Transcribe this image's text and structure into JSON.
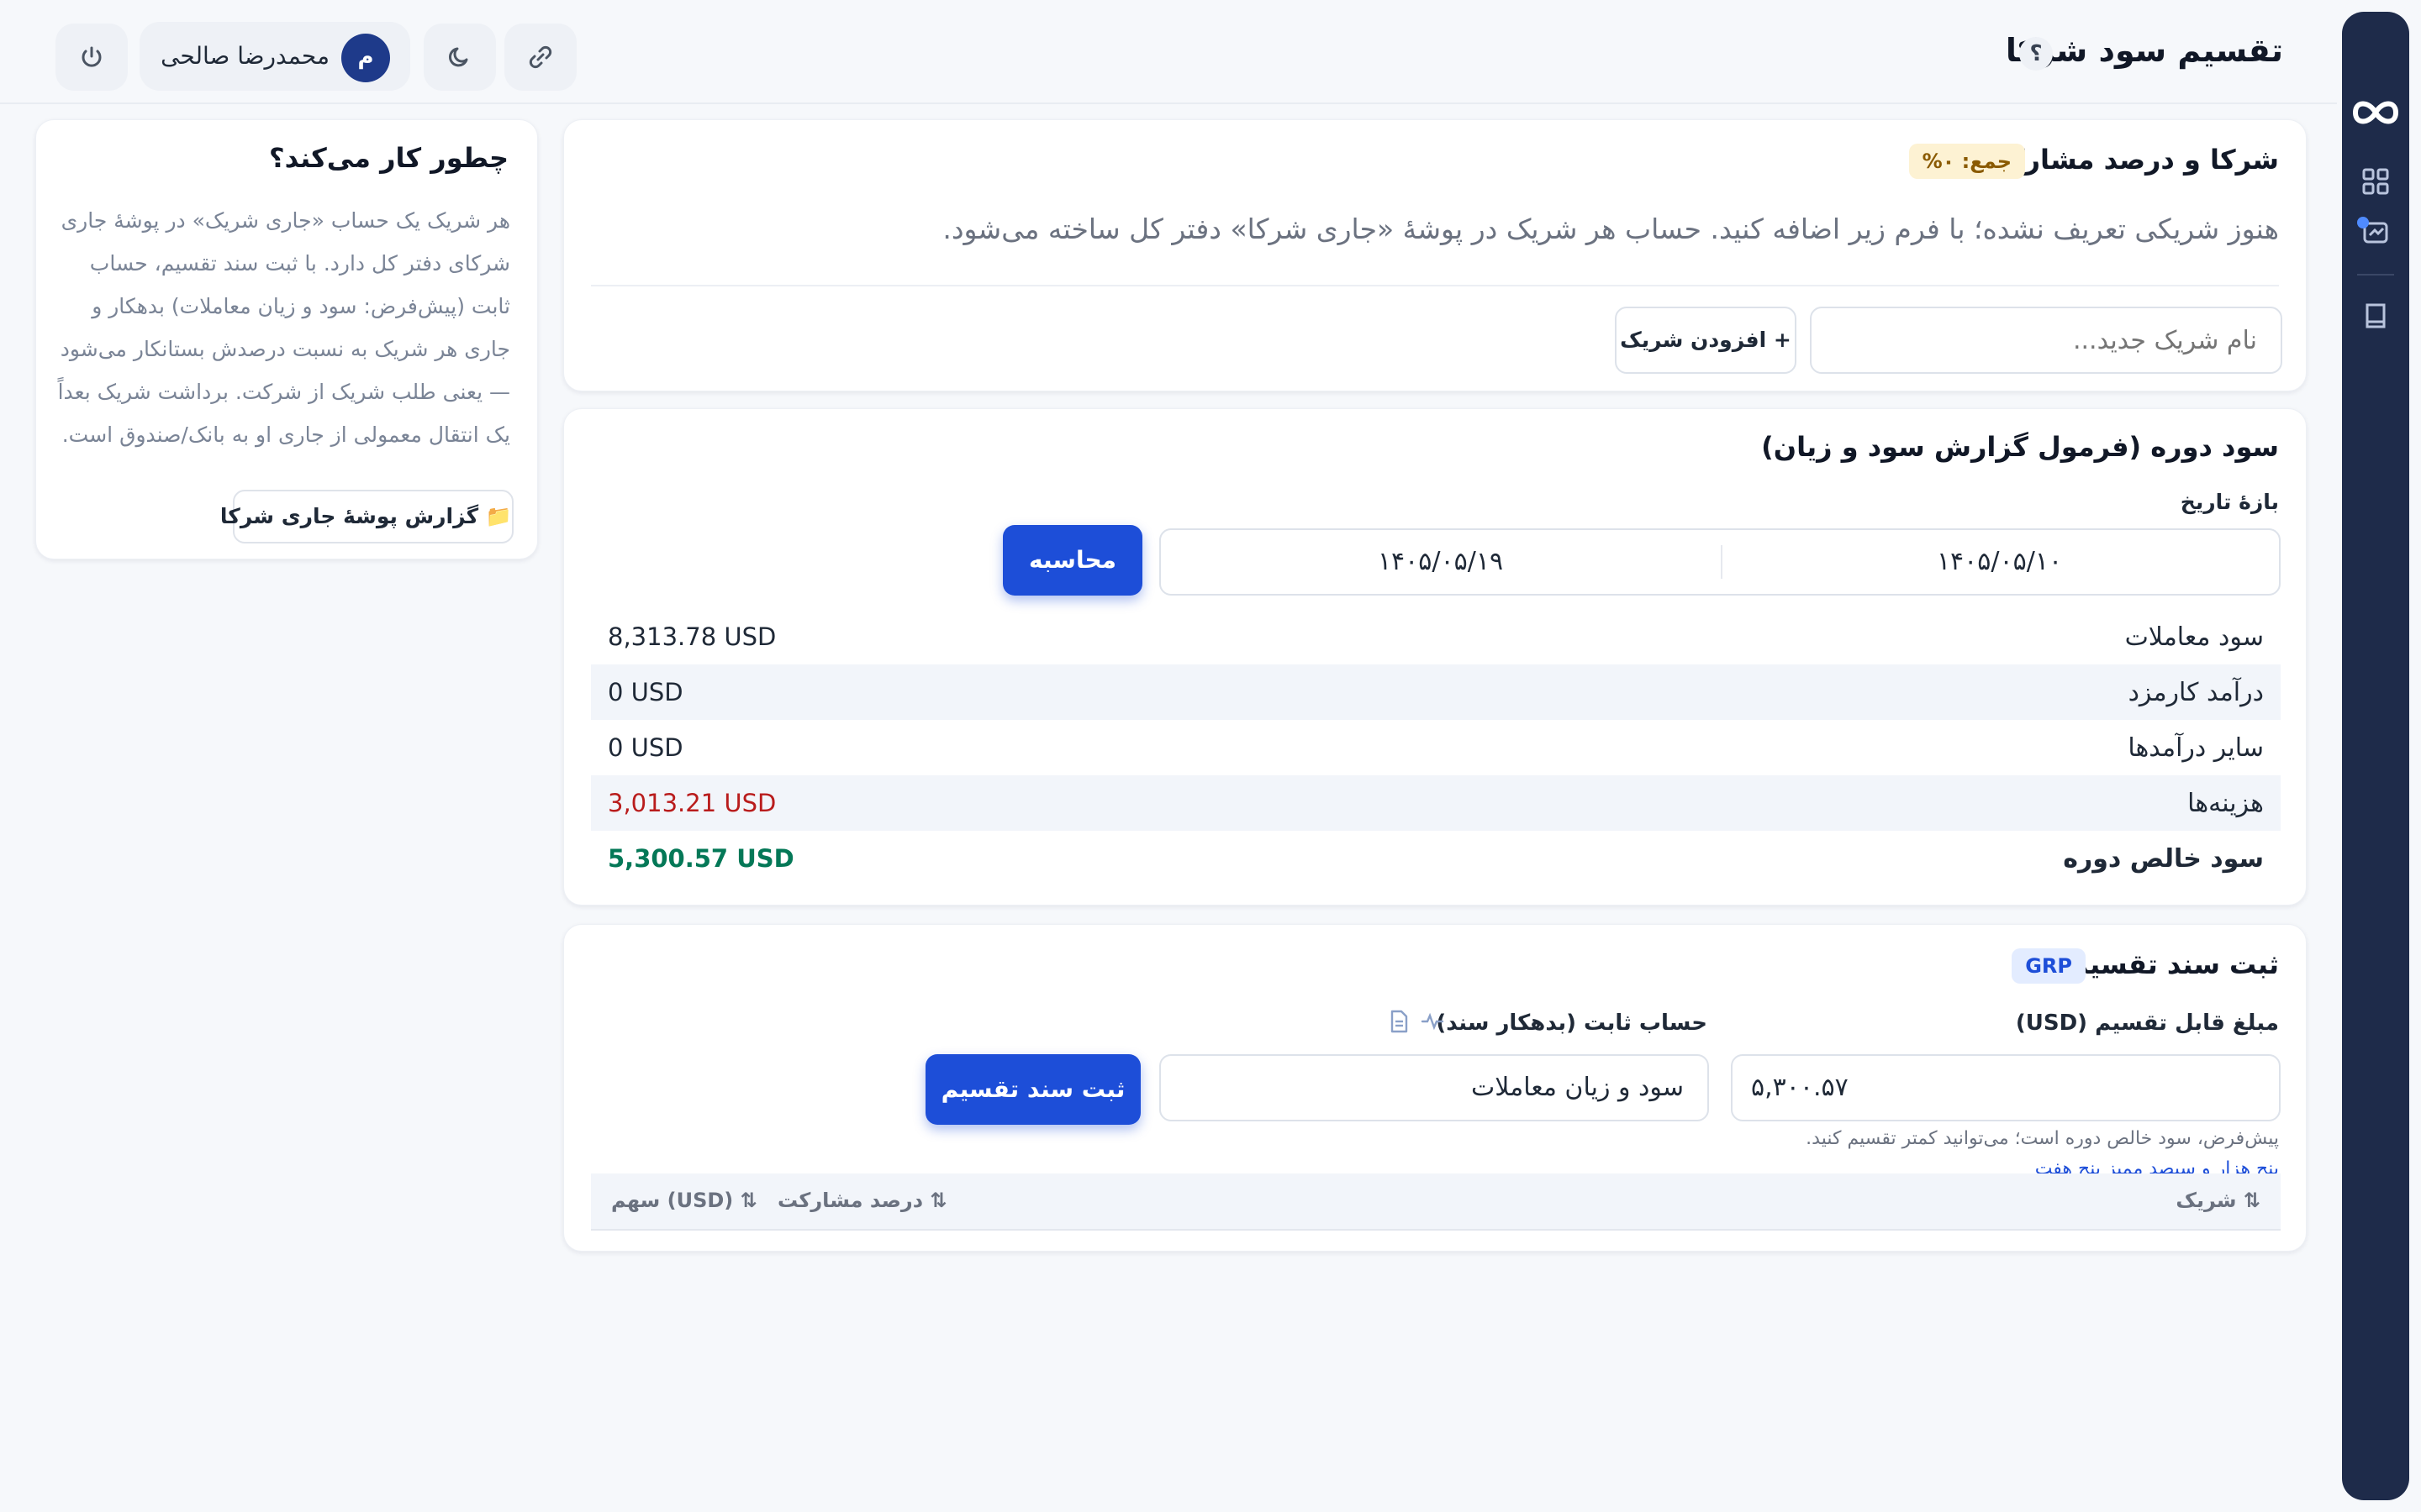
{
  "header": {
    "title": "تقسیم سود شرکا",
    "help_label": "؟",
    "user_name": "محمدرضا صالحی",
    "user_initial": "م"
  },
  "how_it_works": {
    "title": "چطور کار می‌کند؟",
    "body": "هر شریک یک حساب «جاری شریک» در پوشهٔ جاری شرکای دفتر کل دارد. با ثبت سند تقسیم، حساب ثابت (پیش‌فرض: سود و زیان معاملات) بدهکار و جاری هر شریک به نسبت درصدش بستانکار می‌شود — یعنی طلب شریک از شرکت. برداشت شریک بعداً یک انتقال معمولی از جاری او به بانک/صندوق است.",
    "report_button": "📁 گزارش پوشهٔ جاری شرکا"
  },
  "partners": {
    "title": "شرکا و درصد مشارکت",
    "total_badge": "جمع: ۰%",
    "empty_message": "هنوز شریکی تعریف نشده؛ با فرم زیر اضافه کنید. حساب هر شریک در پوشهٔ «جاری شرکا» دفتر کل ساخته می‌شود.",
    "new_partner_placeholder": "نام شریک جدید...",
    "add_button": "+ افزودن شریک"
  },
  "period_profit": {
    "title": "سود دوره (فرمول گزارش سود و زیان)",
    "date_range_label": "بازهٔ تاریخ",
    "date_from": "۱۴۰۵/۰۵/۱۰",
    "date_to": "۱۴۰۵/۰۵/۱۹",
    "calculate_button": "محاسبه",
    "rows": [
      {
        "label": "سود معاملات",
        "value": "8,313.78 USD"
      },
      {
        "label": "درآمد کارمزد",
        "value": "0 USD"
      },
      {
        "label": "سایر درآمدها",
        "value": "0 USD"
      },
      {
        "label": "هزینه‌ها",
        "value": "3,013.21 USD"
      },
      {
        "label": "سود خالص دوره",
        "value": "5,300.57 USD"
      }
    ]
  },
  "distribution": {
    "title": "ثبت سند تقسیم",
    "badge": "GRP",
    "amount_label": "مبلغ قابل تقسیم (USD)",
    "amount_value": "۵,۳۰۰.۵۷",
    "account_label": "حساب ثابت (بدهکار سند)",
    "account_value": "سود و زیان معاملات",
    "submit_button": "ثبت سند تقسیم",
    "hint": "پیش‌فرض، سود خالص دوره است؛ می‌توانید کمتر تقسیم کنید.",
    "amount_in_words": "پنج هزار و سیصد ممیز پنج هفت",
    "table_headers": {
      "partner": "⇅ شریک",
      "percent": "⇅ درصد مشارکت",
      "share": "⇅ (USD) سهم"
    }
  },
  "colors": {
    "sidebar": "#1e2b4a",
    "primary": "#1d4ed8",
    "negative": "#b91c1c",
    "positive": "#047857"
  }
}
